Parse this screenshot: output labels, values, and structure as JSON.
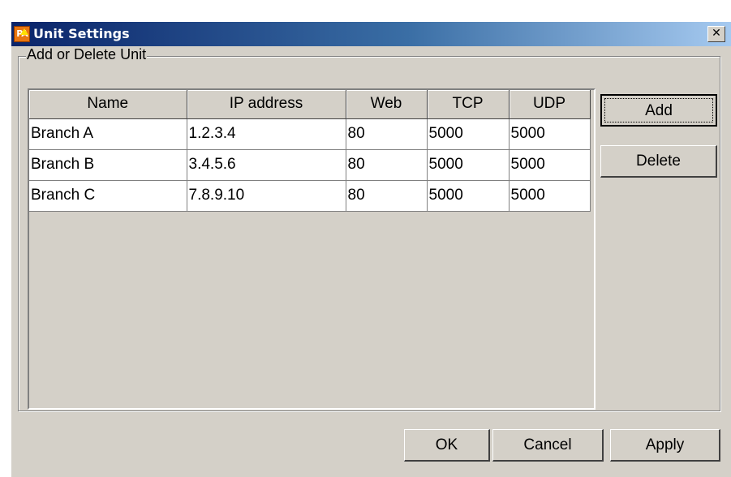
{
  "window": {
    "title": "Unit Settings",
    "icon_text": "PA",
    "close_glyph": "✕"
  },
  "group": {
    "legend": "Add or Delete Unit"
  },
  "table": {
    "columns": [
      "Name",
      "IP address",
      "Web",
      "TCP",
      "UDP"
    ],
    "rows": [
      [
        "Branch A",
        "1.2.3.4",
        "80",
        "5000",
        "5000"
      ],
      [
        "Branch B",
        "3.4.5.6",
        "80",
        "5000",
        "5000"
      ],
      [
        "Branch C",
        "7.8.9.10",
        "80",
        "5000",
        "5000"
      ]
    ]
  },
  "side_buttons": {
    "add": "Add",
    "delete": "Delete"
  },
  "footer_buttons": {
    "ok": "OK",
    "cancel": "Cancel",
    "apply": "Apply"
  },
  "colors": {
    "face": "#d4d0c8",
    "title_start": "#0a246a",
    "title_end": "#a6caf0",
    "icon": "#e87511"
  },
  "icons": {
    "app": "app-logo-icon",
    "close": "close-icon"
  }
}
